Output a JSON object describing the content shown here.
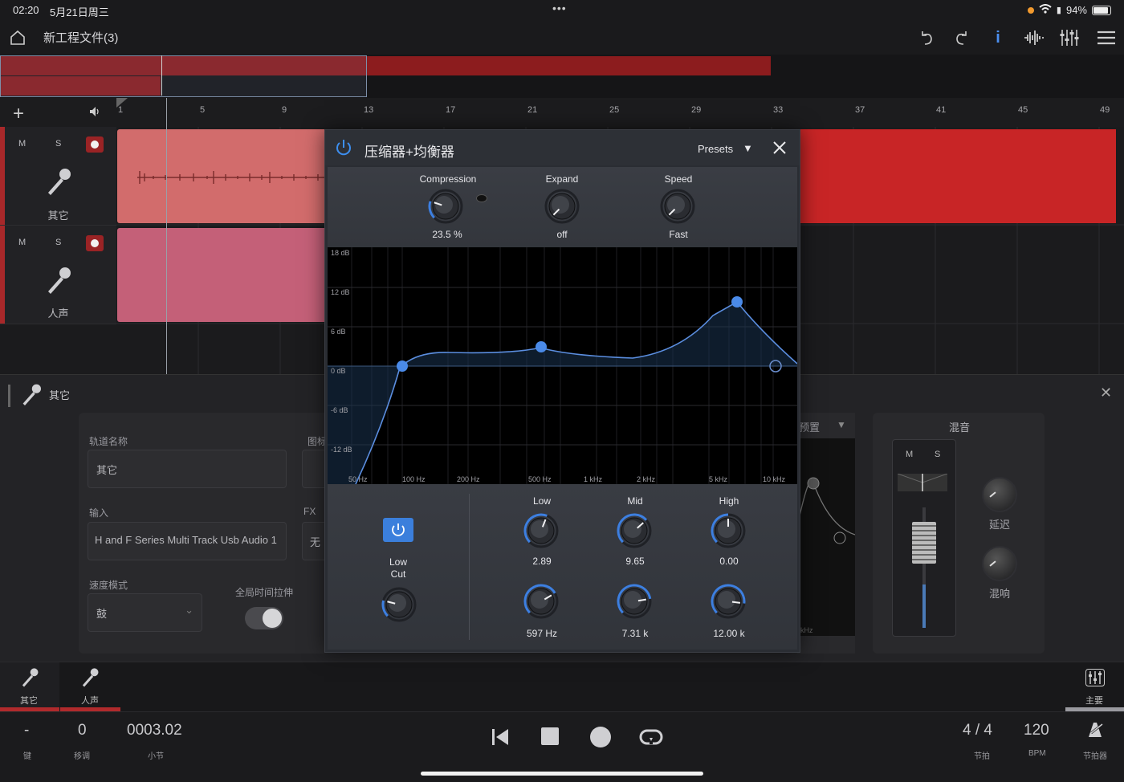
{
  "status": {
    "time": "02:20",
    "date": "5月21日周三",
    "battery": "94%"
  },
  "toolbar": {
    "project_title": "新工程文件(3)"
  },
  "ruler": {
    "marks": [
      "1",
      "5",
      "9",
      "13",
      "17",
      "21",
      "25",
      "29",
      "33",
      "37",
      "41",
      "45",
      "49"
    ]
  },
  "tracks": [
    {
      "name": "其它",
      "mute": "M",
      "solo": "S"
    },
    {
      "name": "人声",
      "mute": "M",
      "solo": "S"
    }
  ],
  "inspector": {
    "track_label": "其它",
    "track_name_label": "轨道名称",
    "track_name_value": "其它",
    "icon_label": "图标",
    "input_label": "输入",
    "input_value": "H and F Series Multi Track Usb Audio 1",
    "fx_label": "FX",
    "fx_value": "无",
    "speed_mode_label": "速度模式",
    "speed_mode_value": "鼓",
    "global_stretch_label": "全局时间拉伸",
    "preset_label": "预置",
    "khz_label": "kHz",
    "mix_title": "混音",
    "mix_m": "M",
    "mix_s": "S",
    "delay_label": "延迟",
    "reverb_label": "混响"
  },
  "plugin": {
    "title": "压缩器+均衡器",
    "presets": "Presets",
    "compression": {
      "label": "Compression",
      "value": "23.5 %",
      "level": 0.235
    },
    "expand": {
      "label": "Expand",
      "value": "off",
      "level": 0.0
    },
    "speed": {
      "label": "Speed",
      "value": "Fast",
      "level": 0.0
    },
    "eq_db_labels": [
      "18 dB",
      "12 dB",
      "6 dB",
      "0 dB",
      "-6 dB",
      "-12 dB"
    ],
    "eq_freq_labels": [
      "50 Hz",
      "100 Hz",
      "200 Hz",
      "500 Hz",
      "1 kHz",
      "2 kHz",
      "5 kHz",
      "10 kHz"
    ],
    "low_cut_label": "Low\nCut",
    "bands": [
      {
        "label": "Low",
        "gain": "2.89",
        "freq": "597 Hz"
      },
      {
        "label": "Mid",
        "gain": "9.65",
        "freq": "7.31 k"
      },
      {
        "label": "High",
        "gain": "0.00",
        "freq": "12.00 k"
      }
    ]
  },
  "tabs": [
    {
      "label": "其它"
    },
    {
      "label": "人声"
    },
    {
      "label": "主要"
    }
  ],
  "transport": {
    "key_value": "-",
    "key_label": "键",
    "transpose_value": "0",
    "transpose_label": "移调",
    "position_value": "0003.02",
    "position_label": "小节",
    "time_sig_value": "4 / 4",
    "time_sig_label": "节拍",
    "tempo_value": "120",
    "tempo_label": "BPM",
    "metronome_label": "节拍器"
  },
  "colors": {
    "accent": "#3d7fe0",
    "record": "#a8282a",
    "clip1": "#d86a6a",
    "clip2": "#c05f77"
  }
}
